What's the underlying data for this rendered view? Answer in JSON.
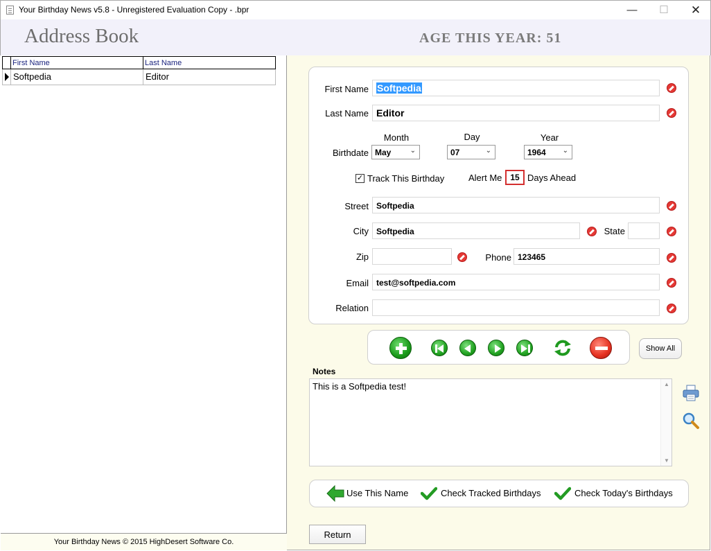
{
  "window": {
    "title": "Your Birthday News v5.8 - Unregistered Evaluation Copy - .bpr",
    "minimize": "—",
    "maximize": "☐",
    "close": "✕"
  },
  "header": {
    "title": "Address Book",
    "age_label": "AGE THIS YEAR:",
    "age_value": "51"
  },
  "grid": {
    "columns": [
      "First Name",
      "Last Name"
    ],
    "rows": [
      {
        "first": "Softpedia",
        "last": "Editor"
      }
    ]
  },
  "footer": {
    "text": "Your Birthday News © 2015 HighDesert Software Co."
  },
  "form": {
    "first_name_label": "First Name",
    "first_name_value": "Softpedia",
    "last_name_label": "Last Name",
    "last_name_value": "Editor",
    "birthdate_label": "Birthdate",
    "month_label": "Month",
    "month_value": "May",
    "day_label": "Day",
    "day_value": "07",
    "year_label": "Year",
    "year_value": "1964",
    "track_label": "Track This Birthday",
    "track_checked": true,
    "alert_label": "Alert Me",
    "alert_value": "15",
    "alert_suffix": "Days Ahead",
    "street_label": "Street",
    "street_value": "Softpedia",
    "city_label": "City",
    "city_value": "Softpedia",
    "state_label": "State",
    "state_value": "",
    "zip_label": "Zip",
    "zip_value": "",
    "phone_label": "Phone",
    "phone_value": "123465",
    "email_label": "Email",
    "email_value": "test@softpedia.com",
    "relation_label": "Relation",
    "relation_value": ""
  },
  "nav": {
    "icons": [
      "add-icon",
      "first-record-icon",
      "previous-record-icon",
      "next-record-icon",
      "last-record-icon",
      "refresh-icon",
      "delete-icon"
    ],
    "show_all_label": "Show All"
  },
  "notes": {
    "label": "Notes",
    "value": "This is a Softpedia test!"
  },
  "actions": {
    "use_name": "Use This Name",
    "check_tracked": "Check Tracked Birthdays",
    "check_today": "Check Today's Birthdays"
  },
  "return_label": "Return",
  "colors": {
    "header_bg": "#f2f1fa",
    "pane_bg": "#fcfbe9",
    "accent_green": "#1a9a1a",
    "accent_red": "#e53020",
    "selection_blue": "#3399ff"
  }
}
